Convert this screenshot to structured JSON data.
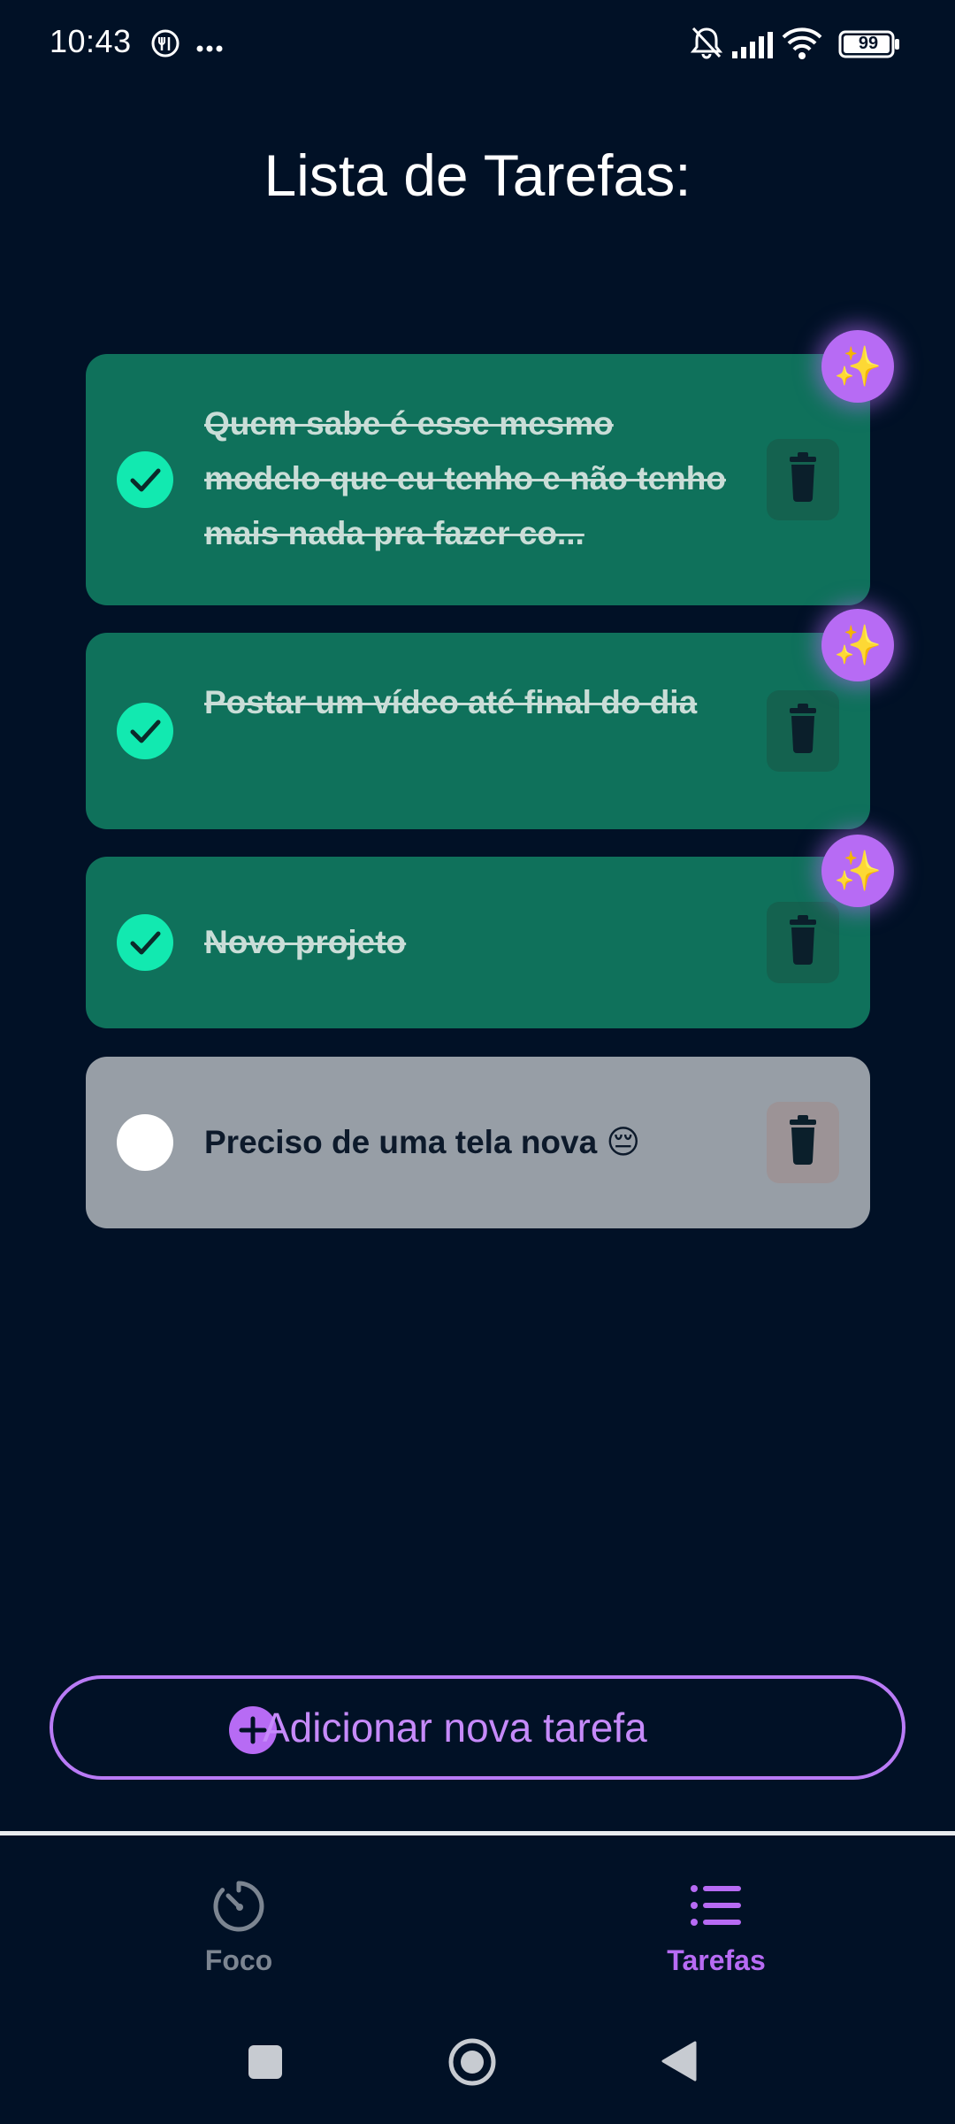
{
  "status_bar": {
    "time": "10:43",
    "battery": "99",
    "icons": [
      "fork-knife-icon",
      "more-dots-icon",
      "bell-off-icon",
      "cell-signal-icon",
      "wifi-icon",
      "battery-icon"
    ]
  },
  "page": {
    "title": "Lista de Tarefas:"
  },
  "tasks": [
    {
      "text": "Quem sabe é esse mesmo modelo que eu tenho e não tenho mais nada pra fazer co...",
      "completed": true
    },
    {
      "text": "Postar um vídeo até final do dia",
      "completed": true
    },
    {
      "text": "Novo projeto",
      "completed": true
    },
    {
      "text": "Preciso de uma tela nova 😔",
      "completed": false
    }
  ],
  "sparkle_emoji": "✨",
  "add_button": {
    "label": "Adicionar nova tarefa"
  },
  "bottom_nav": {
    "items": [
      {
        "label": "Foco",
        "icon": "timer-icon",
        "active": false
      },
      {
        "label": "Tarefas",
        "icon": "list-icon",
        "active": true
      }
    ]
  },
  "colors": {
    "background": "#011126",
    "card_done": "#0f715b",
    "card_pending": "#979ea6",
    "check_done": "#12e9b0",
    "accent_purple": "#b76bf4",
    "nav_inactive": "#7c8591"
  }
}
